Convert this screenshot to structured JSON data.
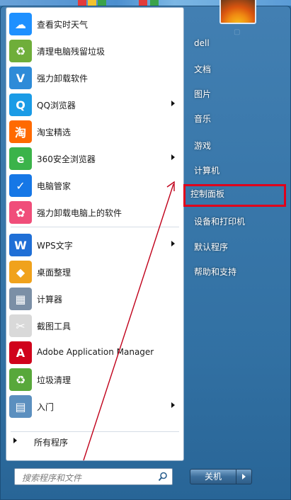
{
  "programs": [
    {
      "label": "查看实时天气",
      "icon": "weather-icon",
      "color": "#1e90ff",
      "glyph": "☁",
      "submenu": false
    },
    {
      "label": "清理电脑残留垃圾",
      "icon": "recycle-icon",
      "color": "#6fae3a",
      "glyph": "♻",
      "submenu": false
    },
    {
      "label": "强力卸载软件",
      "icon": "uninstall-shield-icon",
      "color": "#2e8bd8",
      "glyph": "V",
      "submenu": false
    },
    {
      "label": "QQ浏览器",
      "icon": "qq-browser-icon",
      "color": "#1a9be6",
      "glyph": "Q",
      "submenu": true
    },
    {
      "label": "淘宝精选",
      "icon": "taobao-icon",
      "color": "#ff6a00",
      "glyph": "淘",
      "submenu": false
    },
    {
      "label": "360安全浏览器",
      "icon": "360-browser-icon",
      "color": "#3bb34a",
      "glyph": "e",
      "submenu": true
    },
    {
      "label": "电脑管家",
      "icon": "pc-manager-icon",
      "color": "#1677e6",
      "glyph": "✓",
      "submenu": false
    },
    {
      "label": "强力卸载电脑上的软件",
      "icon": "pinwheel-icon",
      "color": "#f04e7a",
      "glyph": "✿",
      "submenu": false
    },
    {
      "label": "WPS文字",
      "icon": "wps-writer-icon",
      "color": "#1f6fd6",
      "glyph": "W",
      "submenu": true
    },
    {
      "label": "桌面整理",
      "icon": "desktop-organize-icon",
      "color": "#f0a21c",
      "glyph": "◆",
      "submenu": false
    },
    {
      "label": "计算器",
      "icon": "calculator-icon",
      "color": "#7b8fa6",
      "glyph": "▦",
      "submenu": false
    },
    {
      "label": "截图工具",
      "icon": "snipping-tool-icon",
      "color": "#d9d9d9",
      "glyph": "✂",
      "submenu": false
    },
    {
      "label": "Adobe Application Manager",
      "icon": "adobe-icon",
      "color": "#d0021b",
      "glyph": "A",
      "submenu": false
    },
    {
      "label": "垃圾清理",
      "icon": "trash-clean-icon",
      "color": "#58a83b",
      "glyph": "♻",
      "submenu": false
    },
    {
      "label": "入门",
      "icon": "getting-started-icon",
      "color": "#5b8fbf",
      "glyph": "▤",
      "submenu": true
    }
  ],
  "all_programs_label": "所有程序",
  "search": {
    "placeholder": "搜索程序和文件"
  },
  "right_items": [
    {
      "label": "dell",
      "highlight": false
    },
    {
      "label": "文档",
      "highlight": false
    },
    {
      "label": "图片",
      "highlight": false
    },
    {
      "label": "音乐",
      "highlight": false
    },
    {
      "label": "游戏",
      "highlight": false
    },
    {
      "label": "计算机",
      "highlight": false
    },
    {
      "label": "控制面板",
      "highlight": true
    },
    {
      "label": "设备和打印机",
      "highlight": false
    },
    {
      "label": "默认程序",
      "highlight": false
    },
    {
      "label": "帮助和支持",
      "highlight": false
    }
  ],
  "shutdown_label": "关机",
  "colors": {
    "highlight_border": "#e0001b",
    "annotation_arrow": "#c0001a"
  }
}
